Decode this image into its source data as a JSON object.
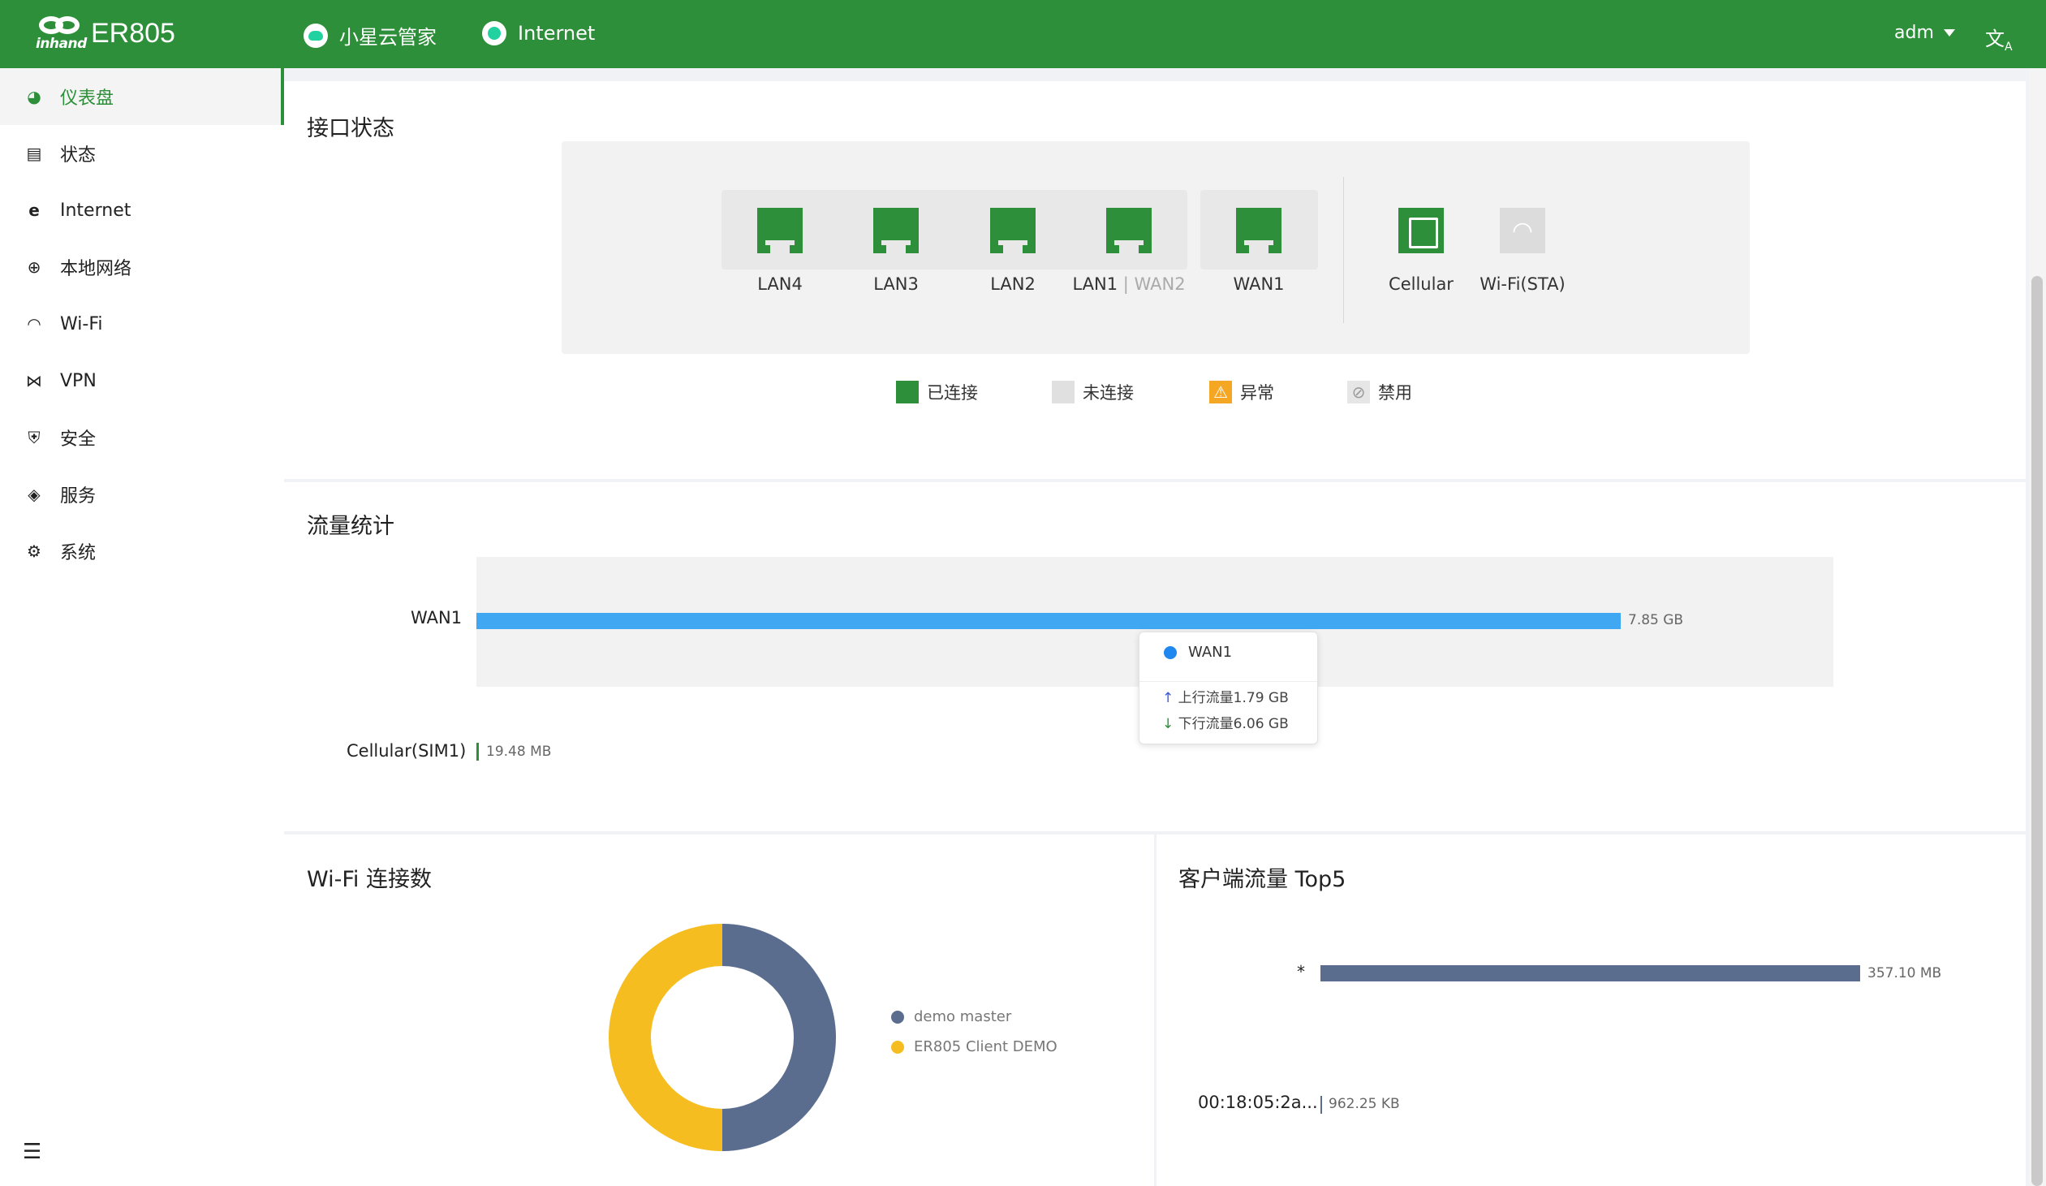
{
  "header": {
    "brand": "inhand",
    "product": "ER805",
    "cloud_label": "小星云管家",
    "internet_label": "Internet",
    "user": "adm",
    "lang_icon": "translate-icon"
  },
  "sidebar": {
    "items": [
      {
        "label": "仪表盘",
        "icon": "dashboard-icon"
      },
      {
        "label": "状态",
        "icon": "status-icon"
      },
      {
        "label": "Internet",
        "icon": "internet-icon"
      },
      {
        "label": "本地网络",
        "icon": "globe-icon"
      },
      {
        "label": "Wi-Fi",
        "icon": "wifi-icon"
      },
      {
        "label": "VPN",
        "icon": "vpn-icon"
      },
      {
        "label": "安全",
        "icon": "shield-icon"
      },
      {
        "label": "服务",
        "icon": "box-icon"
      },
      {
        "label": "系统",
        "icon": "gear-icon"
      }
    ]
  },
  "interfaces": {
    "title": "接口状态",
    "ports": [
      {
        "label": "LAN4"
      },
      {
        "label": "LAN3"
      },
      {
        "label": "LAN2"
      },
      {
        "label": "LAN1",
        "alt": "WAN2"
      },
      {
        "label": "WAN1"
      },
      {
        "label": "Cellular"
      },
      {
        "label": "Wi-Fi(STA)"
      }
    ],
    "legend": [
      {
        "label": "已连接",
        "color": "#2d8f39"
      },
      {
        "label": "未连接",
        "color": "#e0e0e0"
      },
      {
        "label": "异常",
        "color": "#f5a623"
      },
      {
        "label": "禁用",
        "color": "#cfcfcf"
      }
    ]
  },
  "traffic": {
    "title": "流量统计",
    "rows": [
      {
        "name": "WAN1",
        "value": "7.85 GB"
      },
      {
        "name": "Cellular(SIM1)",
        "value": "19.48 MB"
      }
    ],
    "tooltip": {
      "name": "WAN1",
      "up": "上行流量1.79 GB",
      "down": "下行流量6.06 GB"
    }
  },
  "wifi": {
    "title": "Wi-Fi 连接数",
    "series": [
      {
        "name": "demo master",
        "value": 1,
        "color": "#5b6d8f"
      },
      {
        "name": "ER805 Client DEMO",
        "value": 1,
        "color": "#f5bd1f"
      }
    ]
  },
  "clients": {
    "title": "客户端流量 Top5",
    "rows": [
      {
        "name": "*",
        "value": "357.10 MB"
      },
      {
        "name": "00:18:05:2a...",
        "value": "962.25 KB"
      }
    ]
  },
  "chart_data": [
    {
      "type": "bar",
      "title": "流量统计",
      "categories": [
        "WAN1",
        "Cellular(SIM1)"
      ],
      "values": [
        7850,
        19.48
      ],
      "unit": "MB"
    },
    {
      "type": "pie",
      "title": "Wi-Fi 连接数",
      "categories": [
        "demo master",
        "ER805 Client DEMO"
      ],
      "values": [
        1,
        1
      ]
    },
    {
      "type": "bar",
      "title": "客户端流量 Top5",
      "categories": [
        "*",
        "00:18:05:2a..."
      ],
      "values": [
        357.1,
        0.962
      ],
      "unit": "MB"
    }
  ]
}
